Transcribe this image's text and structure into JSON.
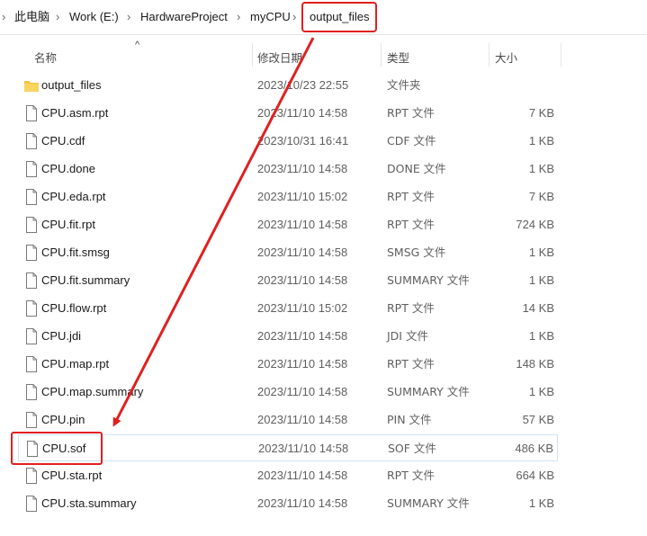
{
  "breadcrumb": {
    "items": [
      "此电脑",
      "Work (E:)",
      "HardwareProject",
      "myCPU",
      "output_files"
    ],
    "separator": "›"
  },
  "columns": {
    "name": "名称",
    "date": "修改日期",
    "type": "类型",
    "size": "大小"
  },
  "files": [
    {
      "name": "output_files",
      "date": "2023/10/23 22:55",
      "type": "文件夹",
      "size": "",
      "icon": "folder-icon"
    },
    {
      "name": "CPU.asm.rpt",
      "date": "2023/11/10 14:58",
      "type": "RPT 文件",
      "size": "7 KB",
      "icon": "file-icon"
    },
    {
      "name": "CPU.cdf",
      "date": "2023/10/31 16:41",
      "type": "CDF 文件",
      "size": "1 KB",
      "icon": "file-icon"
    },
    {
      "name": "CPU.done",
      "date": "2023/11/10 14:58",
      "type": "DONE 文件",
      "size": "1 KB",
      "icon": "file-icon"
    },
    {
      "name": "CPU.eda.rpt",
      "date": "2023/11/10 15:02",
      "type": "RPT 文件",
      "size": "7 KB",
      "icon": "file-icon"
    },
    {
      "name": "CPU.fit.rpt",
      "date": "2023/11/10 14:58",
      "type": "RPT 文件",
      "size": "724 KB",
      "icon": "file-icon"
    },
    {
      "name": "CPU.fit.smsg",
      "date": "2023/11/10 14:58",
      "type": "SMSG 文件",
      "size": "1 KB",
      "icon": "file-icon"
    },
    {
      "name": "CPU.fit.summary",
      "date": "2023/11/10 14:58",
      "type": "SUMMARY 文件",
      "size": "1 KB",
      "icon": "file-icon"
    },
    {
      "name": "CPU.flow.rpt",
      "date": "2023/11/10 15:02",
      "type": "RPT 文件",
      "size": "14 KB",
      "icon": "file-icon"
    },
    {
      "name": "CPU.jdi",
      "date": "2023/11/10 14:58",
      "type": "JDI 文件",
      "size": "1 KB",
      "icon": "file-icon"
    },
    {
      "name": "CPU.map.rpt",
      "date": "2023/11/10 14:58",
      "type": "RPT 文件",
      "size": "148 KB",
      "icon": "file-icon"
    },
    {
      "name": "CPU.map.summary",
      "date": "2023/11/10 14:58",
      "type": "SUMMARY 文件",
      "size": "1 KB",
      "icon": "file-icon"
    },
    {
      "name": "CPU.pin",
      "date": "2023/11/10 14:58",
      "type": "PIN 文件",
      "size": "57 KB",
      "icon": "file-icon"
    },
    {
      "name": "CPU.sof",
      "date": "2023/11/10 14:58",
      "type": "SOF 文件",
      "size": "486 KB",
      "icon": "file-icon",
      "selected": true
    },
    {
      "name": "CPU.sta.rpt",
      "date": "2023/11/10 14:58",
      "type": "RPT 文件",
      "size": "664 KB",
      "icon": "file-icon"
    },
    {
      "name": "CPU.sta.summary",
      "date": "2023/11/10 14:58",
      "type": "SUMMARY 文件",
      "size": "1 KB",
      "icon": "file-icon"
    }
  ],
  "colors": {
    "annotation": "#e02020",
    "folder": "#f4c542",
    "selection_border": "#cfe2f5"
  }
}
